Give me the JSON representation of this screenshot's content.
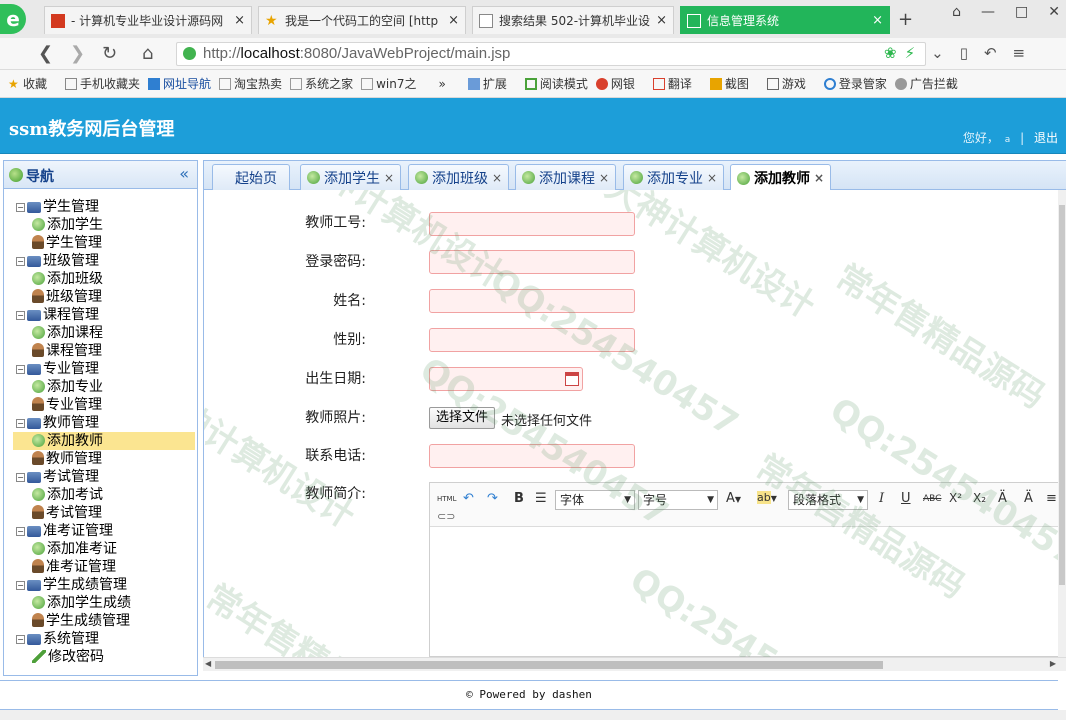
{
  "browser": {
    "logo_glyph": "e",
    "tabs": [
      {
        "title": "- 计算机专业毕业设计源码网",
        "active": false
      },
      {
        "title": "我是一个代码工的空间 [http",
        "active": false
      },
      {
        "title": "搜索结果 502-计算机毕业设",
        "active": false
      },
      {
        "title": "信息管理系统",
        "active": true
      }
    ],
    "tab_close_glyph": "×",
    "new_tab_glyph": "+",
    "window_buttons": [
      "⌂",
      "—",
      "□",
      "✕"
    ],
    "nav": {
      "back": "❮",
      "forward": "❯",
      "reload": "↻",
      "home": "⌂"
    },
    "url_prefix": "http://",
    "url_host": "localhost",
    "url_rest": ":8080/JavaWebProject/main.jsp",
    "addr_right_icons": [
      "❀",
      "⚡",
      "⌄",
      "▯",
      "↶",
      "≡"
    ],
    "bookmarks": [
      "收藏",
      "手机收藏夹",
      "网址导航",
      "淘宝热卖",
      "系统之家",
      "win7之",
      "»",
      "扩展",
      "阅读模式",
      "网银",
      "翻译",
      "截图",
      "游戏",
      "登录管家",
      "广告拦截"
    ]
  },
  "app": {
    "title": "ssm教务网后台管理",
    "greeting": "您好，",
    "username": "a",
    "separator": "|",
    "logout": "退出"
  },
  "nav_panel": {
    "title": "导航",
    "collapse_glyph": "«",
    "groups": [
      {
        "label": "学生管理",
        "children": [
          {
            "label": "添加学生",
            "icon": "add-icon"
          },
          {
            "label": "学生管理",
            "icon": "user-icon"
          }
        ]
      },
      {
        "label": "班级管理",
        "children": [
          {
            "label": "添加班级",
            "icon": "add-icon"
          },
          {
            "label": "班级管理",
            "icon": "user-icon"
          }
        ]
      },
      {
        "label": "课程管理",
        "children": [
          {
            "label": "添加课程",
            "icon": "add-icon"
          },
          {
            "label": "课程管理",
            "icon": "user-icon"
          }
        ]
      },
      {
        "label": "专业管理",
        "children": [
          {
            "label": "添加专业",
            "icon": "add-icon"
          },
          {
            "label": "专业管理",
            "icon": "user-icon"
          }
        ]
      },
      {
        "label": "教师管理",
        "children": [
          {
            "label": "添加教师",
            "icon": "add-icon",
            "selected": true
          },
          {
            "label": "教师管理",
            "icon": "user-icon"
          }
        ]
      },
      {
        "label": "考试管理",
        "children": [
          {
            "label": "添加考试",
            "icon": "add-icon"
          },
          {
            "label": "考试管理",
            "icon": "user-icon"
          }
        ]
      },
      {
        "label": "准考证管理",
        "children": [
          {
            "label": "添加准考证",
            "icon": "add-icon"
          },
          {
            "label": "准考证管理",
            "icon": "user-icon"
          }
        ]
      },
      {
        "label": "学生成绩管理",
        "children": [
          {
            "label": "添加学生成绩",
            "icon": "add-icon"
          },
          {
            "label": "学生成绩管理",
            "icon": "user-icon"
          }
        ]
      },
      {
        "label": "系统管理",
        "children": [
          {
            "label": "修改密码",
            "icon": "pen-icon"
          }
        ]
      }
    ]
  },
  "content_tabs": [
    {
      "label": "起始页",
      "closable": false,
      "icon": false
    },
    {
      "label": "添加学生",
      "closable": true,
      "icon": true
    },
    {
      "label": "添加班级",
      "closable": true,
      "icon": true
    },
    {
      "label": "添加课程",
      "closable": true,
      "icon": true
    },
    {
      "label": "添加专业",
      "closable": true,
      "icon": true
    },
    {
      "label": "添加教师",
      "closable": true,
      "icon": true,
      "active": true
    }
  ],
  "form": {
    "teacher_no_label": "教师工号:",
    "password_label": "登录密码:",
    "name_label": "姓名:",
    "gender_label": "性别:",
    "birthday_label": "出生日期:",
    "photo_label": "教师照片:",
    "photo_button": "选择文件",
    "photo_status": "未选择任何文件",
    "phone_label": "联系电话:",
    "intro_label": "教师简介:",
    "editor": {
      "html_btn": "HTML",
      "bold": "B",
      "font_select": "字体",
      "size_select": "字号",
      "font_color": "A",
      "highlight": "ab",
      "paragraph_select": "段落格式",
      "italic": "I",
      "underline": "U",
      "strike": "ABC",
      "superscript": "X²",
      "subscript": "X₂"
    }
  },
  "footer": "© Powered by dashen",
  "watermarks": [
    "大神计算机设计",
    "QQ:254540457",
    "常年售精品源码",
    "QQ:254540457",
    "大神计算机设计",
    "常年售精品源码",
    "QQ:254540457",
    "大神计算机设计",
    "QQ:254540457",
    "常年售精品源码"
  ],
  "colors": {
    "header_bg": "#1d9ed9",
    "active_tab": "#22b55a",
    "selected_nav": "#fbe591",
    "input_bg": "#fff0f0",
    "input_border": "#f1a2a2",
    "panel_border": "#99bbe8"
  }
}
